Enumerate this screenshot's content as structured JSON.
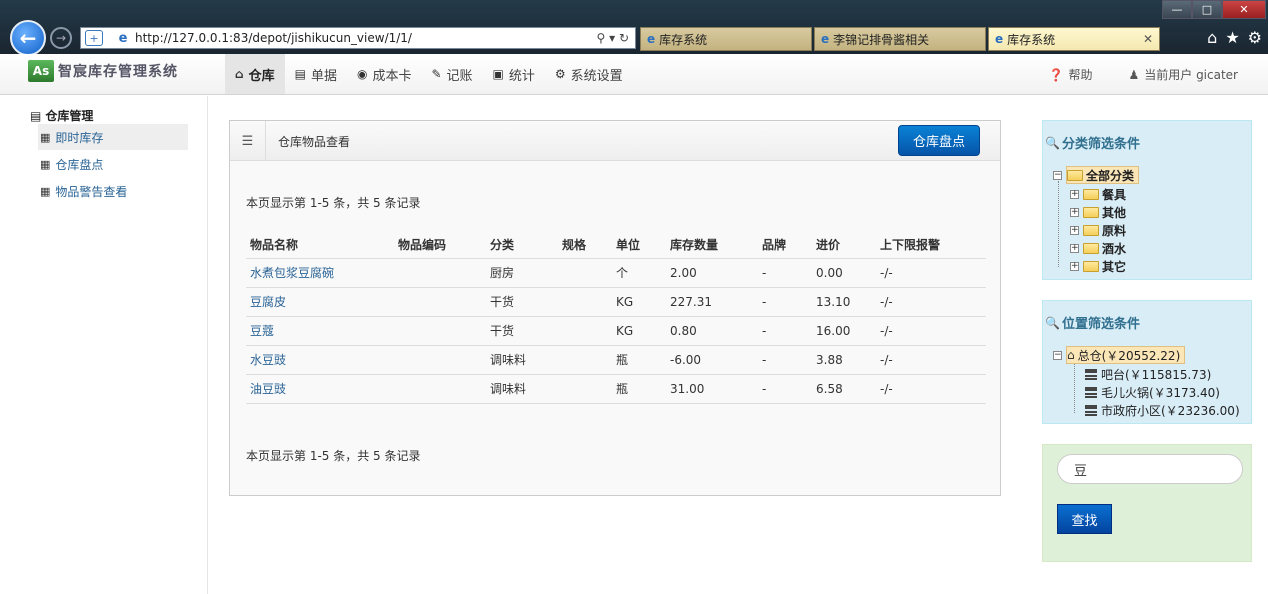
{
  "browser": {
    "url": "http://127.0.0.1:83/depot/jishikucun_view/1/1/",
    "tabs": [
      {
        "title": "库存系统"
      },
      {
        "title": "李锦记排骨酱相关"
      },
      {
        "title": "库存系统"
      }
    ]
  },
  "navbar": {
    "logo_badge": "As",
    "logo_text": "智宸库存管理系统",
    "items": [
      {
        "label": "仓库",
        "icon": "home-icon"
      },
      {
        "label": "单据",
        "icon": "list-icon"
      },
      {
        "label": "成本卡",
        "icon": "eye-icon"
      },
      {
        "label": "记账",
        "icon": "pencil-icon"
      },
      {
        "label": "统计",
        "icon": "picture-icon"
      },
      {
        "label": "系统设置",
        "icon": "gear-icon"
      }
    ],
    "help": "帮助",
    "current_user": "当前用户 gicater"
  },
  "sidebar": {
    "title": "仓库管理",
    "items": [
      {
        "label": "即时库存"
      },
      {
        "label": "仓库盘点"
      },
      {
        "label": "物品警告查看"
      }
    ]
  },
  "panel": {
    "title": "仓库物品查看",
    "stocktake_button": "仓库盘点",
    "page_info_top": "本页显示第 1-5 条，共 5 条记录",
    "page_info_bottom": "本页显示第 1-5 条，共 5 条记录",
    "columns": [
      "物品名称",
      "物品编码",
      "分类",
      "规格",
      "单位",
      "库存数量",
      "品牌",
      "进价",
      "上下限报警"
    ],
    "rows": [
      {
        "name": "水煮包浆豆腐碗",
        "code": "",
        "category": "厨房",
        "spec": "",
        "unit": "个",
        "qty": "2.00",
        "brand": "-",
        "price": "0.00",
        "alarm": "-/-"
      },
      {
        "name": "豆腐皮",
        "code": "",
        "category": "干货",
        "spec": "",
        "unit": "KG",
        "qty": "227.31",
        "brand": "-",
        "price": "13.10",
        "alarm": "-/-"
      },
      {
        "name": "豆蔻",
        "code": "",
        "category": "干货",
        "spec": "",
        "unit": "KG",
        "qty": "0.80",
        "brand": "-",
        "price": "16.00",
        "alarm": "-/-"
      },
      {
        "name": "水豆豉",
        "code": "",
        "category": "调味料",
        "spec": "",
        "unit": "瓶",
        "qty": "-6.00",
        "brand": "-",
        "price": "3.88",
        "alarm": "-/-"
      },
      {
        "name": "油豆豉",
        "code": "",
        "category": "调味料",
        "spec": "",
        "unit": "瓶",
        "qty": "31.00",
        "brand": "-",
        "price": "6.58",
        "alarm": "-/-"
      }
    ]
  },
  "category_filter": {
    "title": "分类筛选条件",
    "root": "全部分类",
    "children": [
      "餐具",
      "其他",
      "原料",
      "酒水",
      "其它"
    ]
  },
  "location_filter": {
    "title": "位置筛选条件",
    "root": "总仓(￥20552.22)",
    "children": [
      "吧台(￥115815.73)",
      "毛儿火锅(￥3173.40)",
      "市政府小区(￥23236.00)"
    ]
  },
  "search": {
    "value": "豆",
    "button": "查找"
  }
}
